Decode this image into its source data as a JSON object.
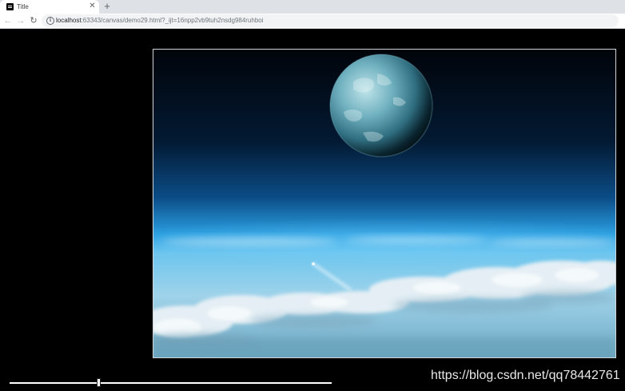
{
  "browser": {
    "tab": {
      "title": "Title",
      "favicon": "webstorm-icon"
    },
    "new_tab_symbol": "+",
    "close_symbol": "✕",
    "address": {
      "host": "localhost",
      "path": ":63343/canvas/demo29.html?_ijt=16npp2vb9tuh2nsdg984ruhboi"
    }
  },
  "icons": {
    "back": "back-arrow-icon",
    "forward": "forward-arrow-icon",
    "reload": "reload-icon",
    "info": "info-icon"
  },
  "page": {
    "canvas_image": "earth-planet-above-clouds",
    "progress": {
      "fraction": 0.275
    }
  },
  "watermark": "https://blog.csdn.net/qq78442761",
  "colors": {
    "page_background": "#000000",
    "tabstrip": "#dee1e6",
    "sky_top": "#01070f",
    "sky_horizon": "#2aa0dd",
    "clouds": "#dde9f0"
  }
}
